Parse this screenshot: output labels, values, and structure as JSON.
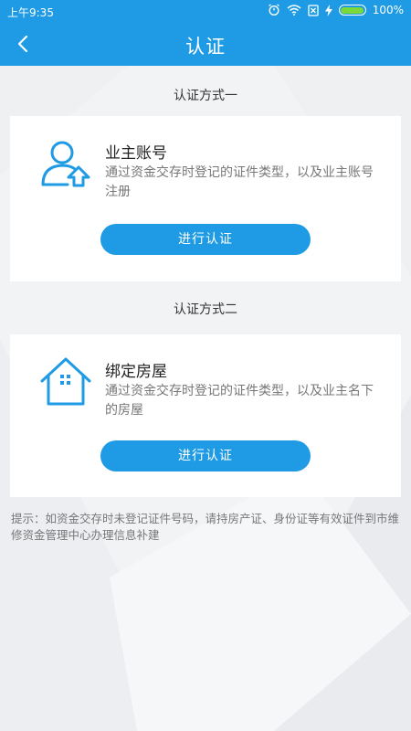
{
  "status_bar": {
    "time": "上午9:35",
    "battery_text": "100%",
    "icons": [
      "alarm-icon",
      "wifi-icon",
      "no-sim-icon",
      "charging-icon",
      "battery-icon"
    ]
  },
  "header": {
    "back_icon": "chevron-left-icon",
    "title": "认证"
  },
  "methods": [
    {
      "section_title": "认证方式一",
      "icon": "user-upload-icon",
      "name": "业主账号",
      "description": "通过资金交存时登记的证件类型，以及业主账号注册",
      "button_label": "进行认证"
    },
    {
      "section_title": "认证方式二",
      "icon": "house-icon",
      "name": "绑定房屋",
      "description": "通过资金交存时登记的证件类型，以及业主名下的房屋",
      "button_label": "进行认证"
    }
  ],
  "tip": "提示：如资金交存时未登记证件号码，请持房产证、身份证等有效证件到市维修资金管理中心办理信息补建",
  "colors": {
    "primary": "#1e9be4",
    "background": "#f2f3f5",
    "card": "#ffffff",
    "battery_fill": "#7bd83b"
  }
}
